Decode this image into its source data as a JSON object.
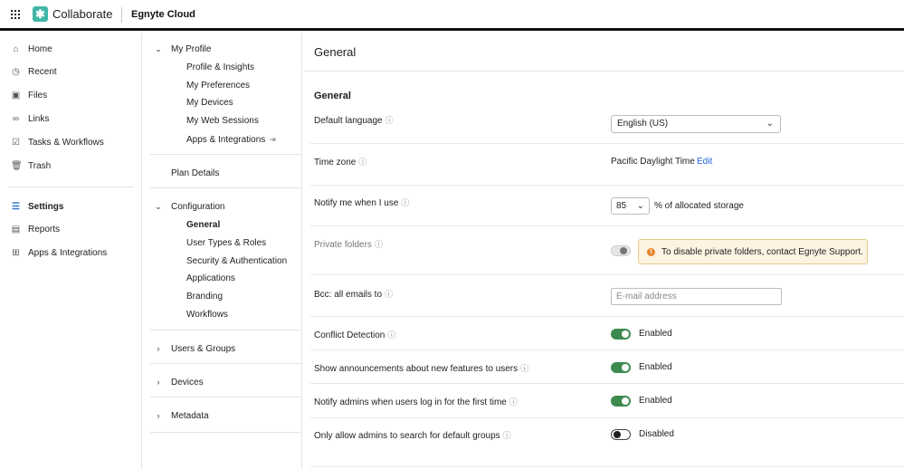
{
  "topbar": {
    "app_name": "Collaborate",
    "tenant": "Egnyte Cloud"
  },
  "leftnav": {
    "items": [
      {
        "label": "Home",
        "icon": "home-icon"
      },
      {
        "label": "Recent",
        "icon": "clock-icon"
      },
      {
        "label": "Files",
        "icon": "file-icon"
      },
      {
        "label": "Links",
        "icon": "link-icon"
      },
      {
        "label": "Tasks & Workflows",
        "icon": "task-icon"
      },
      {
        "label": "Trash",
        "icon": "trash-icon"
      }
    ],
    "admin_items": [
      {
        "label": "Settings",
        "icon": "settings-icon",
        "active": true
      },
      {
        "label": "Reports",
        "icon": "report-icon"
      },
      {
        "label": "Apps & Integrations",
        "icon": "apps-icon"
      }
    ]
  },
  "midnav": {
    "my_profile": {
      "label": "My Profile",
      "items": [
        "Profile & Insights",
        "My Preferences",
        "My Devices",
        "My Web Sessions",
        "Apps & Integrations"
      ]
    },
    "plan_details": "Plan Details",
    "configuration": {
      "label": "Configuration",
      "items": [
        "General",
        "User Types & Roles",
        "Security & Authentication",
        "Applications",
        "Branding",
        "Workflows"
      ]
    },
    "users_groups": "Users & Groups",
    "devices": "Devices",
    "metadata": "Metadata"
  },
  "main": {
    "page_title": "General",
    "section_title": "General",
    "default_language": {
      "label": "Default language",
      "value": "English (US)"
    },
    "time_zone": {
      "label": "Time zone",
      "value": "Pacific Daylight Time",
      "edit": "Edit"
    },
    "notify_storage": {
      "label": "Notify me when I use",
      "value": "85",
      "suffix": "% of allocated storage"
    },
    "private_folders": {
      "label": "Private folders",
      "warning": "To disable private folders, contact Egnyte Support."
    },
    "bcc": {
      "label": "Bcc: all emails to",
      "placeholder": "E-mail address"
    },
    "conflict_detection": {
      "label": "Conflict Detection",
      "state": "Enabled"
    },
    "announcements": {
      "label": "Show announcements about new features to users",
      "state": "Enabled"
    },
    "notify_admins": {
      "label": "Notify admins when users log in for the first time",
      "state": "Enabled"
    },
    "admin_search": {
      "label": "Only allow admins to search for default groups",
      "state": "Disabled"
    }
  },
  "colors": {
    "accent": "#3d8b4f",
    "link": "#2563d6",
    "warning_bg": "#fdf3e2",
    "logo": "#3fb5a6"
  }
}
